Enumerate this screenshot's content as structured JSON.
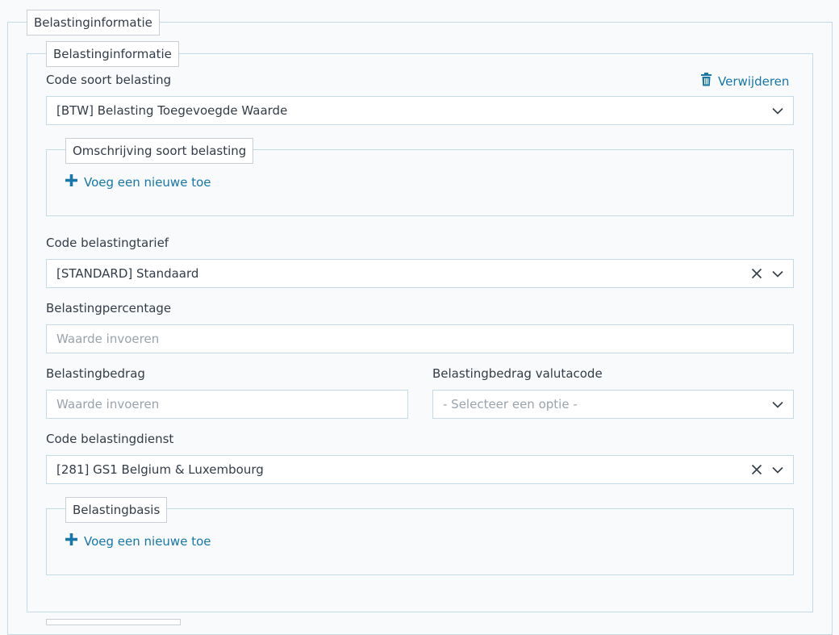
{
  "outer": {
    "legend": "Belastinginformatie"
  },
  "inner": {
    "legend": "Belastinginformatie",
    "delete_label": "Verwijderen",
    "tax_type": {
      "label": "Code soort belasting",
      "value": "[BTW] Belasting Toegevoegde Waarde"
    },
    "tax_type_description": {
      "legend": "Omschrijving soort belasting",
      "add_label": "Voeg een nieuwe toe"
    },
    "tax_rate_code": {
      "label": "Code belastingtarief",
      "value": "[STANDARD] Standaard"
    },
    "tax_percentage": {
      "label": "Belastingpercentage",
      "placeholder": "Waarde invoeren"
    },
    "tax_amount": {
      "label": "Belastingbedrag",
      "placeholder": "Waarde invoeren"
    },
    "tax_amount_currency": {
      "label": "Belastingbedrag valutacode",
      "placeholder": "- Selecteer een optie -"
    },
    "tax_authority": {
      "label": "Code belastingdienst",
      "value": "[281] GS1 Belgium & Luxembourg"
    },
    "tax_basis": {
      "legend": "Belastingbasis",
      "add_label": "Voeg een nieuwe toe"
    }
  },
  "colors": {
    "accent": "#1677a8",
    "border": "#c4dbe6",
    "text": "#333c47",
    "placeholder": "#9aa3ab"
  },
  "icons": [
    "trash-icon",
    "chevron-down-icon",
    "clear-icon",
    "plus-icon"
  ]
}
